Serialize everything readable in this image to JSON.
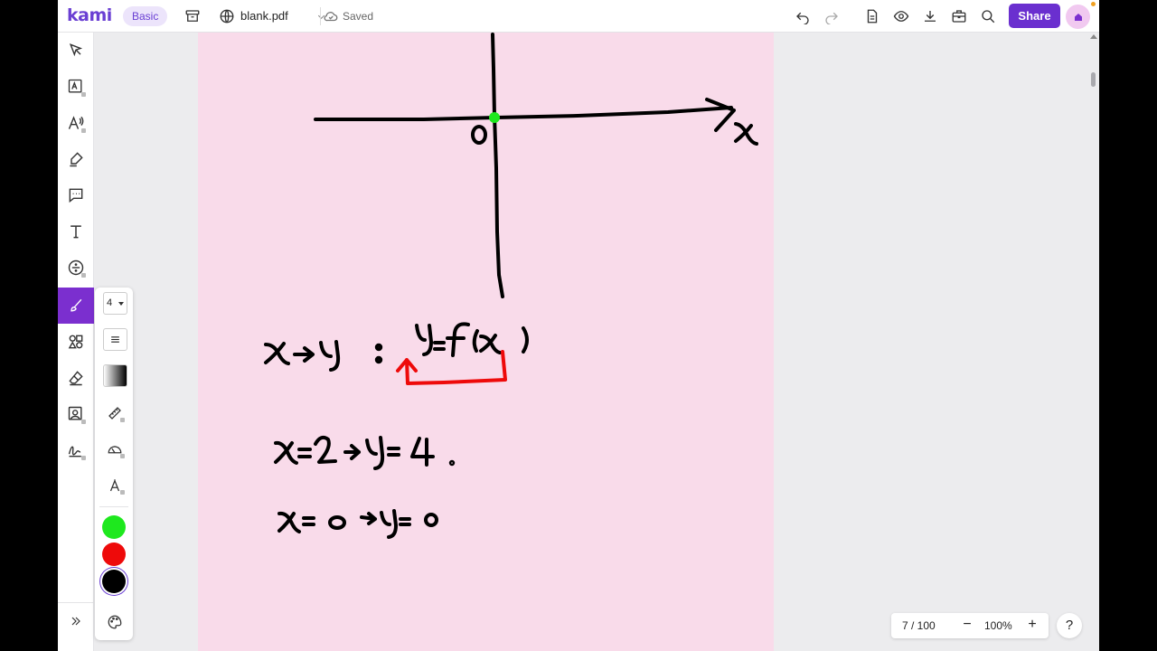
{
  "header": {
    "logo": "kami",
    "plan_badge": "Basic",
    "file_name": "blank.pdf",
    "save_status": "Saved",
    "share_label": "Share"
  },
  "sidebar": {
    "tools": [
      "select",
      "text-recognition",
      "read-aloud",
      "markup",
      "comment",
      "text",
      "equation",
      "drawing",
      "shapes",
      "eraser",
      "add-media",
      "signature"
    ],
    "active_tool": "drawing"
  },
  "drawing_panel": {
    "stroke_size": "4",
    "colors": [
      "#1ee81e",
      "#ee0a0a",
      "#000000"
    ],
    "selected_color": "#000000"
  },
  "page": {
    "background": "#f9dbea",
    "axis_labels": {
      "origin": "0",
      "x": "x"
    },
    "equations": [
      "x→y : y=f(x)",
      "x=2 → y= 4 .",
      "x= 0 →y= 0"
    ]
  },
  "footer": {
    "page_counter": "7 / 100",
    "zoom_level": "100%",
    "help": "?"
  }
}
